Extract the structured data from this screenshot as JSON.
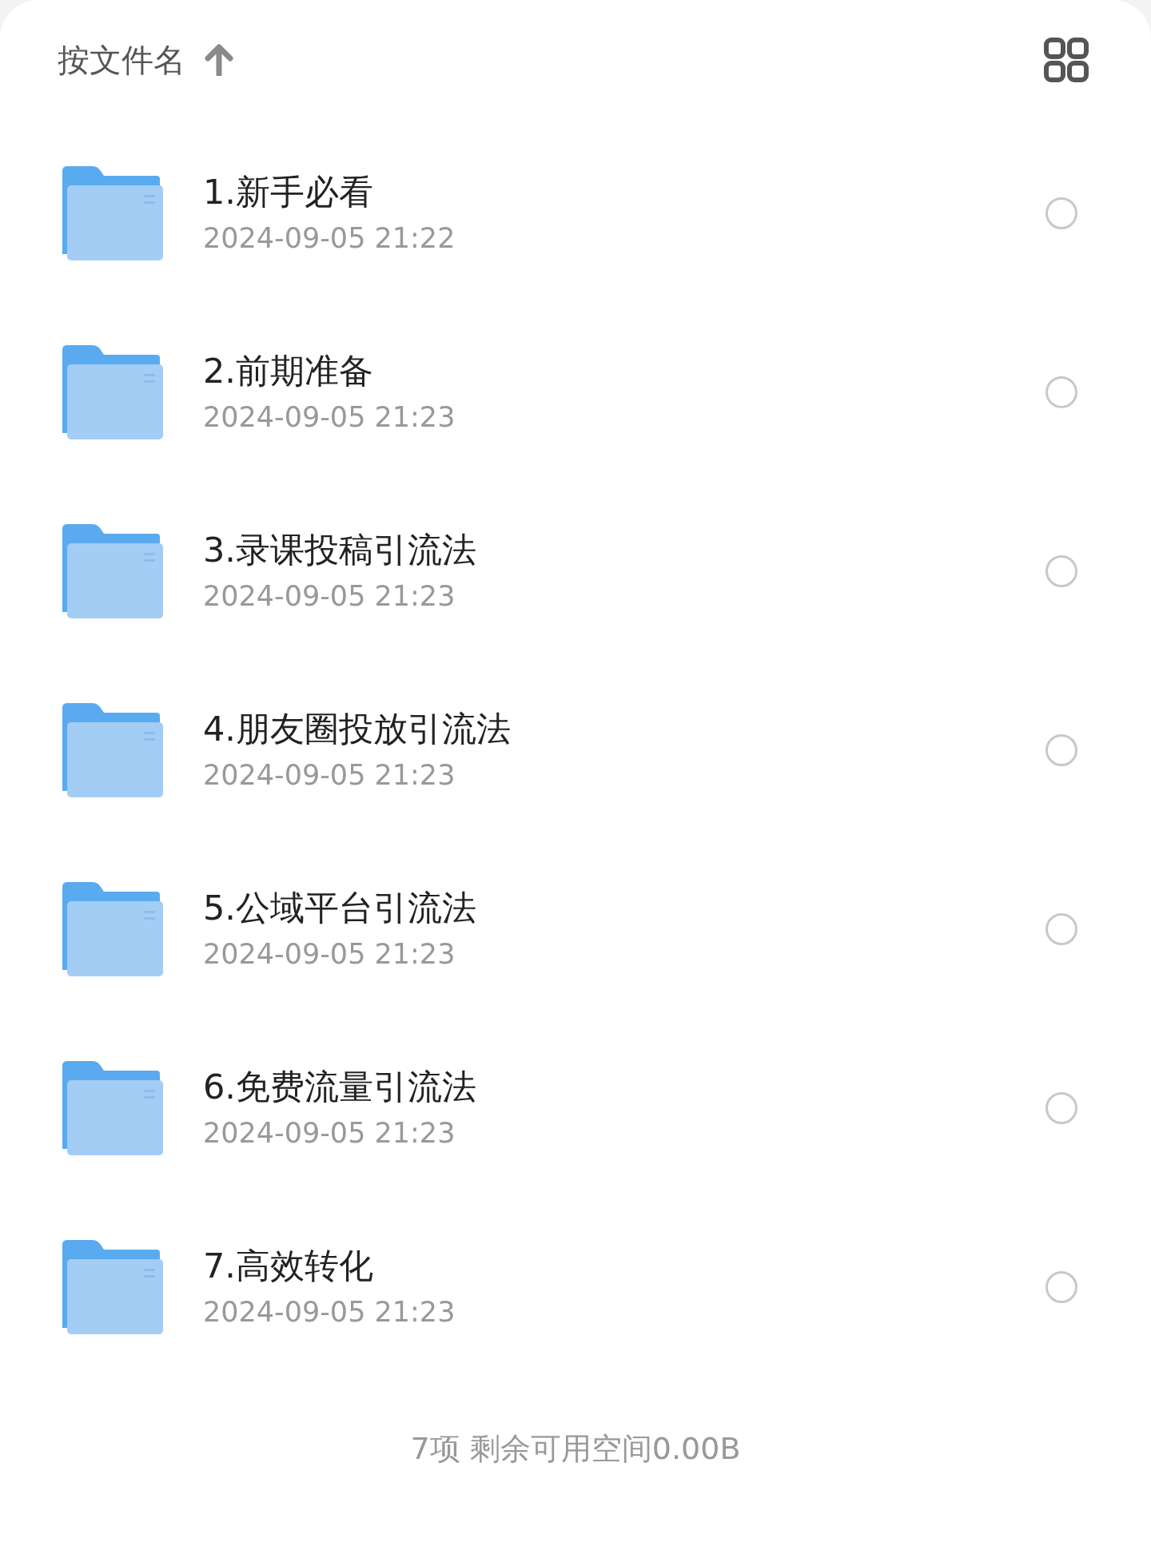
{
  "sort_bar": {
    "label": "按文件名",
    "ascending": true
  },
  "files": [
    {
      "name": "1.新手必看",
      "date": "2024-09-05 21:22",
      "selected": false
    },
    {
      "name": "2.前期准备",
      "date": "2024-09-05 21:23",
      "selected": false
    },
    {
      "name": "3.录课投稿引流法",
      "date": "2024-09-05 21:23",
      "selected": false
    },
    {
      "name": "4.朋友圈投放引流法",
      "date": "2024-09-05 21:23",
      "selected": false
    },
    {
      "name": "5.公域平台引流法",
      "date": "2024-09-05 21:23",
      "selected": false
    },
    {
      "name": "6.免费流量引流法",
      "date": "2024-09-05 21:23",
      "selected": false
    },
    {
      "name": "7.高效转化",
      "date": "2024-09-05 21:23",
      "selected": false
    }
  ],
  "footer": "7项 剩余可用空间0.00B"
}
